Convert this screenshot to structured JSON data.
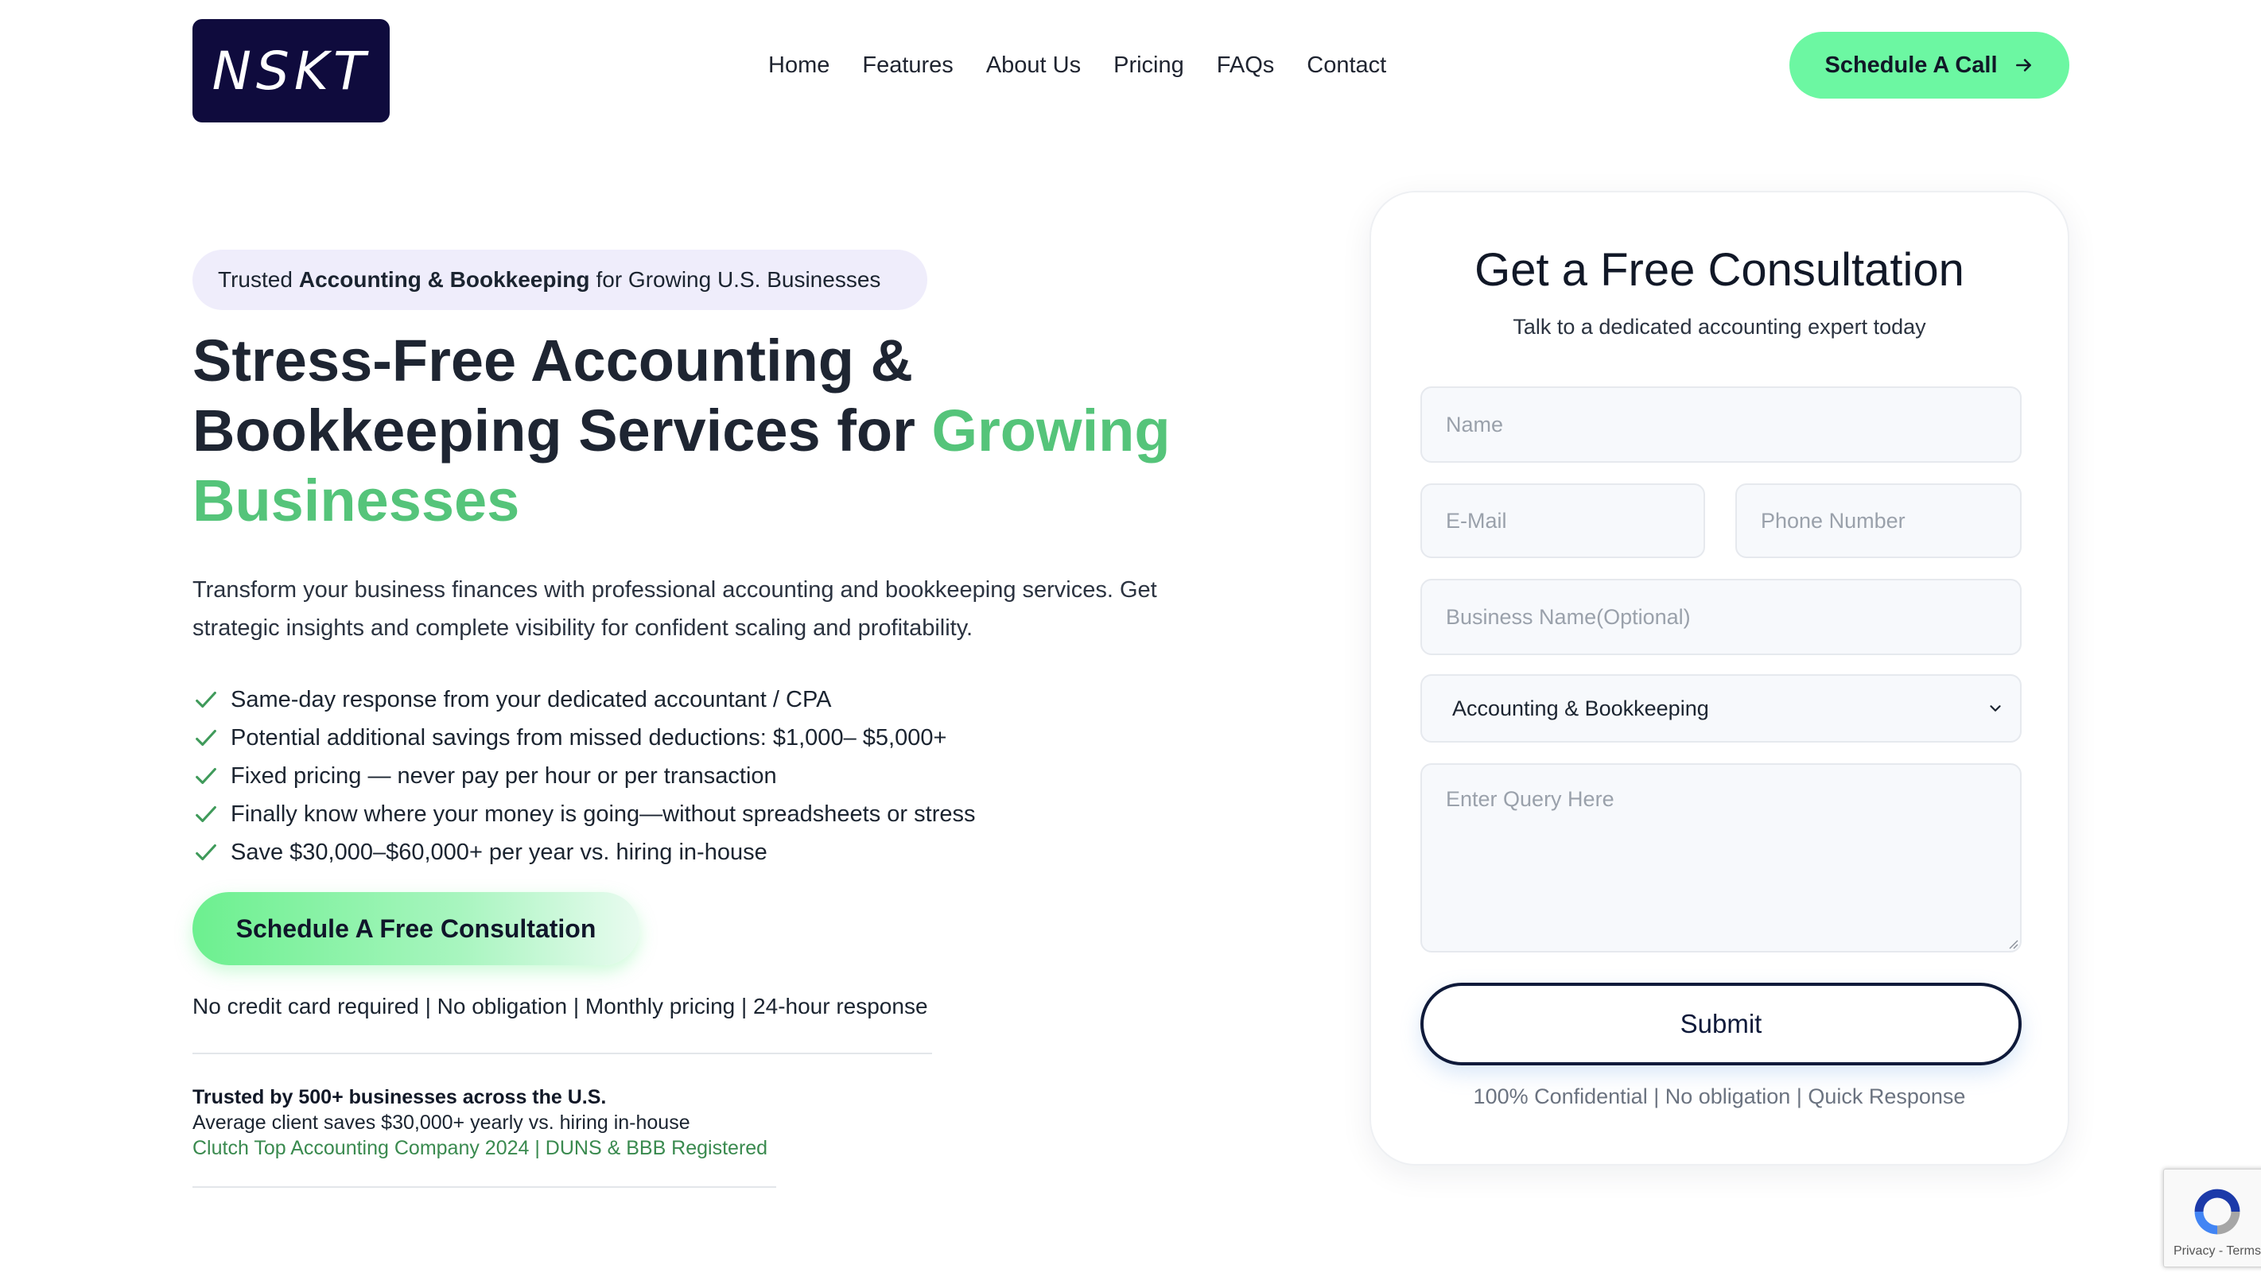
{
  "brand": {
    "logo_text": "NSKT",
    "logo_bg": "#0f0b3d"
  },
  "nav": {
    "items": [
      {
        "label": "Home"
      },
      {
        "label": "Features"
      },
      {
        "label": "About Us"
      },
      {
        "label": "Pricing"
      },
      {
        "label": "FAQs"
      },
      {
        "label": "Contact"
      }
    ]
  },
  "header_cta": {
    "label": "Schedule A Call",
    "color": "#6cf7a2"
  },
  "hero": {
    "pill": {
      "prefix": "Trusted",
      "bold": "Accounting & Bookkeeping",
      "suffix": "for Growing U.S. Businesses"
    },
    "headline": {
      "line1": "Stress-Free Accounting &",
      "line2": "Bookkeeping Services for",
      "highlight_a": "Growing",
      "highlight_b": "Businesses",
      "highlight_color": "#55c47a"
    },
    "intro": "Transform your business finances with professional accounting and bookkeeping services. Get strategic insights and complete visibility for confident scaling and profitability.",
    "benefits": [
      "Same-day response from your dedicated accountant / CPA",
      "Potential additional savings from missed deductions: $1,000– $5,000+",
      "Fixed pricing — never pay per hour or per transaction",
      "Finally know where your money is going—without spreadsheets or stress",
      "Save $30,000–$60,000+ per year vs. hiring in-house"
    ],
    "cta_label": "Schedule A Free Consultation",
    "assurance": "No credit card required | No obligation | Monthly pricing | 24-hour response",
    "trust": {
      "line1": "Trusted by 500+ businesses across the U.S.",
      "line2": "Average client saves $30,000+ yearly vs. hiring in-house",
      "line3": "Clutch Top Accounting Company 2024 | DUNS & BBB Registered"
    }
  },
  "form": {
    "title": "Get a Free Consultation",
    "subtitle": "Talk to a dedicated accounting expert today",
    "name_placeholder": "Name",
    "email_placeholder": "E-Mail",
    "phone_placeholder": "Phone Number",
    "business_placeholder": "Business Name(Optional)",
    "service_selected": "Accounting & Bookkeeping",
    "query_placeholder": "Enter Query Here",
    "submit_label": "Submit",
    "footer": "100% Confidential | No obligation | Quick Response"
  },
  "recaptcha": {
    "links": "Privacy - Terms"
  }
}
